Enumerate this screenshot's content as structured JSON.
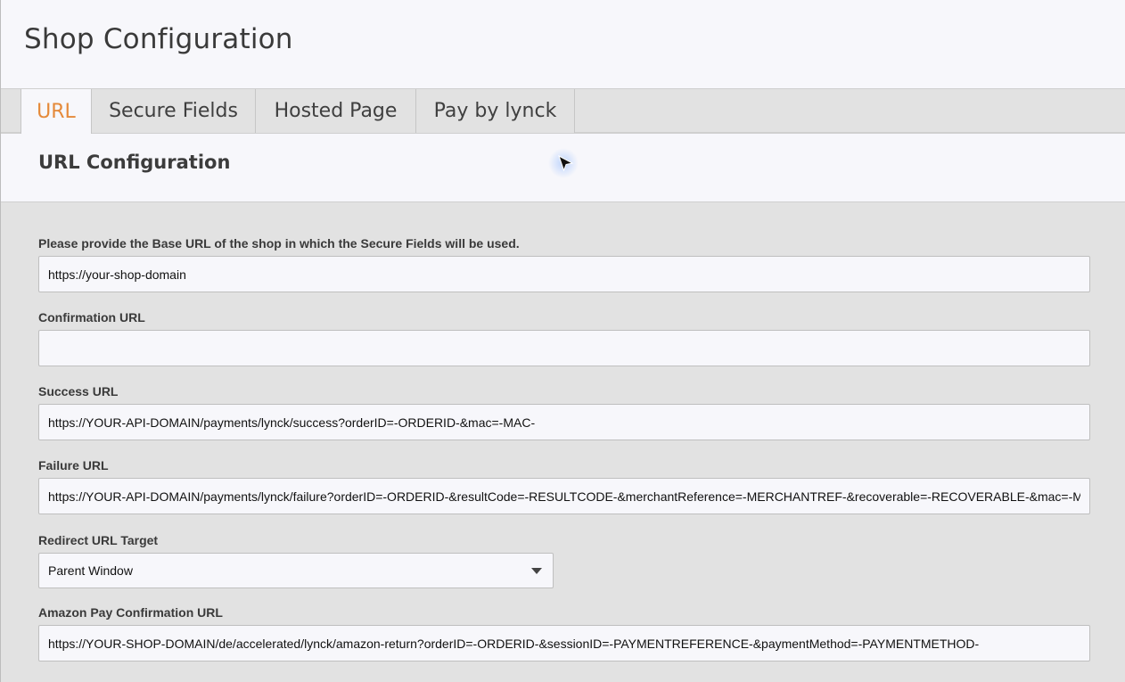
{
  "page": {
    "title": "Shop Configuration"
  },
  "tabs": [
    {
      "label": "URL",
      "active": true
    },
    {
      "label": "Secure Fields",
      "active": false
    },
    {
      "label": "Hosted Page",
      "active": false
    },
    {
      "label": "Pay by lynck",
      "active": false
    }
  ],
  "section": {
    "title": "URL Configuration"
  },
  "fields": {
    "base_url": {
      "label": "Please provide the Base URL of the shop in which the Secure Fields will be used.",
      "value": "https://your-shop-domain"
    },
    "confirmation_url": {
      "label": "Confirmation URL",
      "value": ""
    },
    "success_url": {
      "label": "Success URL",
      "value": "https://YOUR-API-DOMAIN/payments/lynck/success?orderID=-ORDERID-&mac=-MAC-"
    },
    "failure_url": {
      "label": "Failure URL",
      "value": "https://YOUR-API-DOMAIN/payments/lynck/failure?orderID=-ORDERID-&resultCode=-RESULTCODE-&merchantReference=-MERCHANTREF-&recoverable=-RECOVERABLE-&mac=-MAC-"
    },
    "redirect_target": {
      "label": "Redirect URL Target",
      "value": "Parent Window"
    },
    "amazon_confirmation_url": {
      "label": "Amazon Pay Confirmation URL",
      "value": "https://YOUR-SHOP-DOMAIN/de/accelerated/lynck/amazon-return?orderID=-ORDERID-&sessionID=-PAYMENTREFERENCE-&paymentMethod=-PAYMENTMETHOD-"
    }
  },
  "icons": {
    "select_caret": "chevron-down-icon",
    "cursor": "mouse-pointer-icon"
  },
  "colors": {
    "accent": "#e58a3a",
    "background": "#e2e2e2",
    "panel": "#f7f7fb"
  }
}
